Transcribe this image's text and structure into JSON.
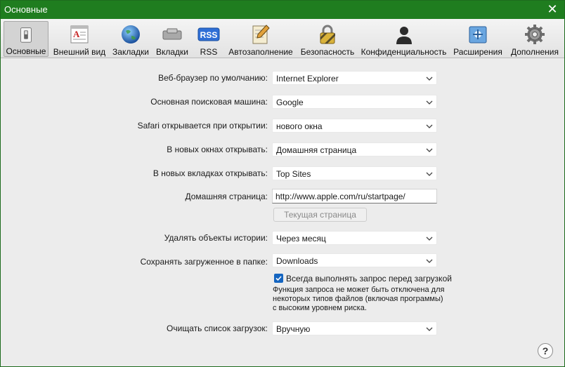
{
  "window": {
    "title": "Основные",
    "close_glyph": "✕"
  },
  "toolbar": {
    "items": [
      {
        "label": "Основные",
        "icon": "switch-icon",
        "active": true
      },
      {
        "label": "Внешний вид",
        "icon": "appearance-icon"
      },
      {
        "label": "Закладки",
        "icon": "globe-icon"
      },
      {
        "label": "Вкладки",
        "icon": "tabs-icon"
      },
      {
        "label": "RSS",
        "icon": "rss-icon",
        "badge": "RSS"
      },
      {
        "label": "Автозаполнение",
        "icon": "autofill-pencil-icon"
      },
      {
        "label": "Безопасность",
        "icon": "lock-icon"
      },
      {
        "label": "Конфиденциальность",
        "icon": "person-silhouette-icon"
      },
      {
        "label": "Расширения",
        "icon": "puzzle-icon"
      },
      {
        "label": "Дополнения",
        "icon": "gear-icon"
      }
    ]
  },
  "form": {
    "default_browser": {
      "label": "Веб-браузер по умолчанию:",
      "value": "Internet Explorer"
    },
    "search_engine": {
      "label": "Основная поисковая машина:",
      "value": "Google"
    },
    "safari_opens": {
      "label": "Safari открывается при открытии:",
      "value": "нового окна"
    },
    "new_windows": {
      "label": "В новых окнах открывать:",
      "value": "Домашняя страница"
    },
    "new_tabs": {
      "label": "В новых вкладках открывать:",
      "value": "Top Sites"
    },
    "homepage": {
      "label": "Домашняя страница:",
      "value": "http://www.apple.com/ru/startpage/"
    },
    "current_page_button": "Текущая страница",
    "remove_history": {
      "label": "Удалять объекты истории:",
      "value": "Через месяц"
    },
    "save_downloads": {
      "label": "Сохранять загруженное в папке:",
      "value": "Downloads"
    },
    "always_ask": {
      "label": "Всегда выполнять запрос перед загрузкой",
      "checked": true
    },
    "note": "Функция запроса не может быть отключена для некоторых типов файлов (включая программы) с высоким уровнем риска.",
    "clear_downloads": {
      "label": "Очищать список загрузок:",
      "value": "Вручную"
    }
  },
  "help": {
    "glyph": "?"
  },
  "colors": {
    "titlebar": "#1f7d1f",
    "checkbox": "#1565c0",
    "window_bg": "#ececec"
  }
}
